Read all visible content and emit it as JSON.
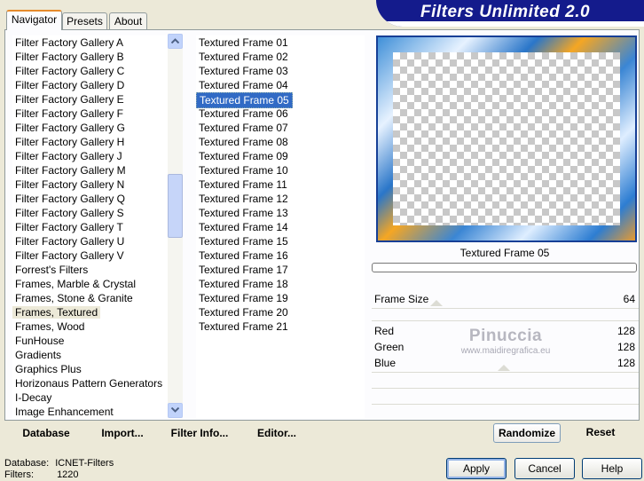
{
  "tabs": [
    "Navigator",
    "Presets",
    "About"
  ],
  "banner_title": "Filters Unlimited 2.0",
  "categories": [
    "Filter Factory Gallery A",
    "Filter Factory Gallery B",
    "Filter Factory Gallery C",
    "Filter Factory Gallery D",
    "Filter Factory Gallery E",
    "Filter Factory Gallery F",
    "Filter Factory Gallery G",
    "Filter Factory Gallery H",
    "Filter Factory Gallery J",
    "Filter Factory Gallery M",
    "Filter Factory Gallery N",
    "Filter Factory Gallery Q",
    "Filter Factory Gallery S",
    "Filter Factory Gallery T",
    "Filter Factory Gallery U",
    "Filter Factory Gallery V",
    "Forrest's Filters",
    "Frames, Marble & Crystal",
    "Frames, Stone & Granite",
    "Frames, Textured",
    "Frames, Wood",
    "FunHouse",
    "Gradients",
    "Graphics Plus",
    "Horizonaus Pattern Generators",
    "I-Decay",
    "Image Enhancement"
  ],
  "selected_category": "Frames, Textured",
  "filters": [
    "Textured Frame 01",
    "Textured Frame 02",
    "Textured Frame 03",
    "Textured Frame 04",
    "Textured Frame 05",
    "Textured Frame 06",
    "Textured Frame 07",
    "Textured Frame 08",
    "Textured Frame 09",
    "Textured Frame 10",
    "Textured Frame 11",
    "Textured Frame 12",
    "Textured Frame 13",
    "Textured Frame 14",
    "Textured Frame 15",
    "Textured Frame 16",
    "Textured Frame 17",
    "Textured Frame 18",
    "Textured Frame 19",
    "Textured Frame 20",
    "Textured Frame 21"
  ],
  "selected_filter": "Textured Frame 05",
  "preview_caption": "Textured Frame 05",
  "params": [
    {
      "label": "Frame Size",
      "value": "64"
    },
    {
      "label": "Red",
      "value": "128"
    },
    {
      "label": "Green",
      "value": "128"
    },
    {
      "label": "Blue",
      "value": "128"
    }
  ],
  "watermark": {
    "name": "Pinuccia",
    "url": "www.maidiregrafica.eu"
  },
  "toolbar": {
    "database": "Database",
    "import": "Import...",
    "filter_info": "Filter Info...",
    "editor": "Editor...",
    "randomize": "Randomize",
    "reset": "Reset"
  },
  "status": {
    "database_label": "Database:",
    "database_value": "ICNET-Filters",
    "filters_label": "Filters:",
    "filters_value": "1220"
  },
  "buttons": {
    "apply": "Apply",
    "cancel": "Cancel",
    "help": "Help"
  },
  "colors": {
    "banner": "#141b8c",
    "selection": "#316ac5",
    "tab_accent": "#e68b2c"
  }
}
